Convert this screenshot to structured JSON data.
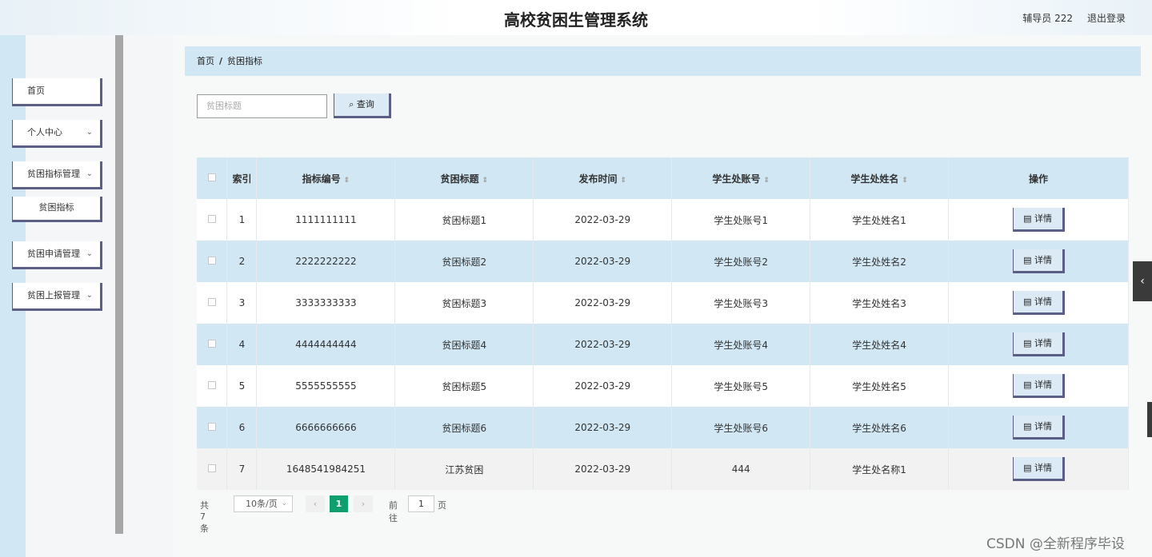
{
  "header": {
    "title": "高校贫困生管理系统",
    "user": "辅导员 222",
    "logout": "退出登录"
  },
  "sidebar": {
    "items": [
      {
        "label": "首页"
      },
      {
        "label": "个人中心"
      },
      {
        "label": "贫困指标管理"
      },
      {
        "label": "贫困指标"
      },
      {
        "label": "贫困申请管理"
      },
      {
        "label": "贫困上报管理"
      }
    ]
  },
  "breadcrumb": {
    "home": "首页",
    "sep": "/",
    "current": "贫困指标"
  },
  "search": {
    "placeholder": "贫困标题",
    "button": "查询"
  },
  "table": {
    "headers": [
      "索引",
      "指标编号",
      "贫困标题",
      "发布时间",
      "学生处账号",
      "学生处姓名",
      "操作"
    ],
    "rows": [
      {
        "index": "1",
        "code": "1111111111",
        "title": "贫困标题1",
        "date": "2022-03-29",
        "account": "学生处账号1",
        "name": "学生处姓名1",
        "action": "详情"
      },
      {
        "index": "2",
        "code": "2222222222",
        "title": "贫困标题2",
        "date": "2022-03-29",
        "account": "学生处账号2",
        "name": "学生处姓名2",
        "action": "详情"
      },
      {
        "index": "3",
        "code": "3333333333",
        "title": "贫困标题3",
        "date": "2022-03-29",
        "account": "学生处账号3",
        "name": "学生处姓名3",
        "action": "详情"
      },
      {
        "index": "4",
        "code": "4444444444",
        "title": "贫困标题4",
        "date": "2022-03-29",
        "account": "学生处账号4",
        "name": "学生处姓名4",
        "action": "详情"
      },
      {
        "index": "5",
        "code": "5555555555",
        "title": "贫困标题5",
        "date": "2022-03-29",
        "account": "学生处账号5",
        "name": "学生处姓名5",
        "action": "详情"
      },
      {
        "index": "6",
        "code": "6666666666",
        "title": "贫困标题6",
        "date": "2022-03-29",
        "account": "学生处账号6",
        "name": "学生处姓名6",
        "action": "详情"
      },
      {
        "index": "7",
        "code": "1648541984251",
        "title": "江苏贫困",
        "date": "2022-03-29",
        "account": "444",
        "name": "学生处名称1",
        "action": "详情"
      }
    ]
  },
  "pagination": {
    "total": "共 7 条",
    "page_size": "10条/页",
    "current": "1",
    "goto_label": "前往",
    "goto_value": "1",
    "page_unit": "页"
  },
  "watermark": "CSDN @全新程序毕设",
  "colors": {
    "accent_blue": "#d1e7f4",
    "border": "#5c5f85",
    "page_active": "#0e9f6e"
  }
}
